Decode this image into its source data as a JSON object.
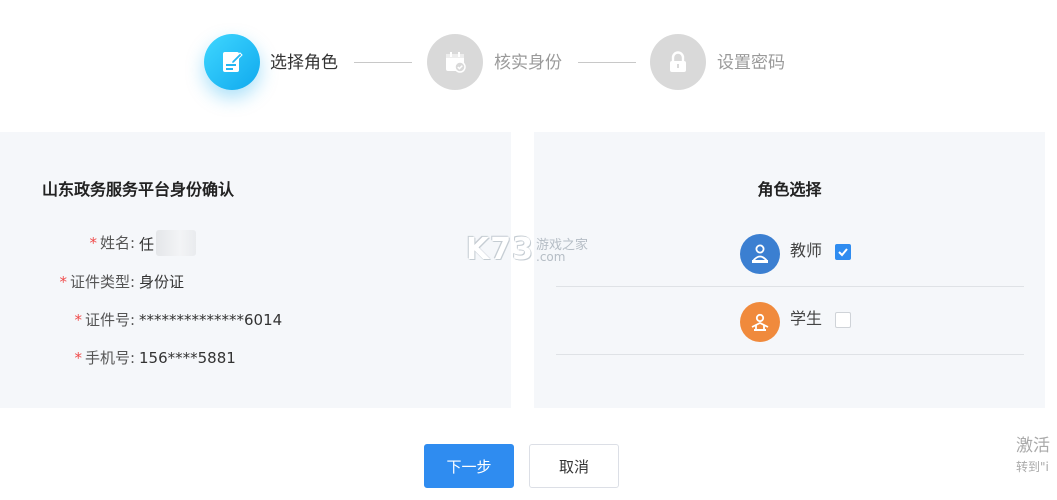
{
  "steps": [
    {
      "label": "选择角色",
      "state": "active",
      "icon": "document-edit-icon"
    },
    {
      "label": "核实身份",
      "state": "inactive",
      "icon": "calendar-check-icon"
    },
    {
      "label": "设置密码",
      "state": "inactive",
      "icon": "lock-icon"
    }
  ],
  "identity": {
    "title": "山东政务服务平台身份确认",
    "required_mark": "*",
    "fields": [
      {
        "label": "姓名:",
        "value": "任"
      },
      {
        "label": "证件类型:",
        "value": "身份证"
      },
      {
        "label": "证件号:",
        "value": "**************6014"
      },
      {
        "label": "手机号:",
        "value": "156****5881"
      }
    ]
  },
  "roles": {
    "title": "角色选择",
    "items": [
      {
        "label": "教师",
        "checked": true,
        "icon": "teacher-icon",
        "color": "#3b7fd1"
      },
      {
        "label": "学生",
        "checked": false,
        "icon": "student-icon",
        "color": "#f08a3c"
      }
    ]
  },
  "watermark": {
    "brand": "K73",
    "name": "游戏之家",
    "domain": ".com"
  },
  "buttons": {
    "next": "下一步",
    "cancel": "取消"
  },
  "os_overlay": {
    "title": "激活",
    "subtitle": "转到\"i"
  },
  "colors": {
    "primary": "#2f8cf0",
    "step_active": "#10a9ee",
    "required": "#f04b4b"
  }
}
